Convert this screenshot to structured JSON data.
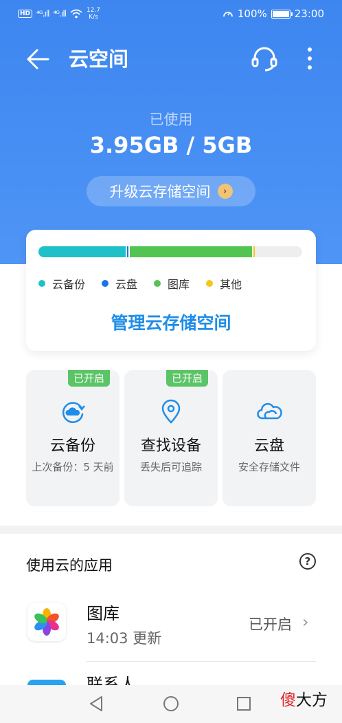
{
  "status_bar": {
    "hd": "HD",
    "sig1": "⁴ᴳ.ıll",
    "sig2": "⁴ᴳ.ıll",
    "speed_value": "12.7",
    "speed_unit": "K/s",
    "battery": "100%",
    "battery_level": 1.0,
    "time": "23:00"
  },
  "header": {
    "title": "云空间"
  },
  "storage": {
    "used_label": "已使用",
    "used_value": "3.95GB / 5GB",
    "upgrade_label": "升级云存储空间",
    "segments": [
      {
        "name": "云备份",
        "fraction": 0.33,
        "color": "#1fc0c7"
      },
      {
        "name": "云盘",
        "fraction": 0.01,
        "color": "#1a73e8"
      },
      {
        "name": "图库",
        "fraction": 0.47,
        "color": "#52c452"
      },
      {
        "name": "其他",
        "fraction": 0.01,
        "color": "#f5c518"
      }
    ],
    "legend": [
      {
        "label": "云备份",
        "color": "#1fc0c7"
      },
      {
        "label": "云盘",
        "color": "#1a73e8"
      },
      {
        "label": "图库",
        "color": "#52c452"
      },
      {
        "label": "其他",
        "color": "#f5c518"
      }
    ],
    "manage_label": "管理云存储空间"
  },
  "tiles": [
    {
      "badge": "已开启",
      "name": "云备份",
      "desc": "上次备份：5 天前",
      "icon": "cloud-backup-icon"
    },
    {
      "badge": "已开启",
      "name": "查找设备",
      "desc": "丢失后可追踪",
      "icon": "location-pin-icon"
    },
    {
      "badge": "",
      "name": "云盘",
      "desc": "安全存储文件",
      "icon": "cloud-icon"
    }
  ],
  "apps": {
    "title": "使用云的应用",
    "help": "?",
    "items": [
      {
        "name": "图库",
        "time": "14:03 更新",
        "status": "已开启"
      }
    ],
    "next_item_name": "联系人"
  },
  "watermark": {
    "red": "傻",
    "rest": "大方"
  },
  "colors": {
    "accent": "#1f8de8",
    "hero": "#3d86f0",
    "badge": "#5bc466"
  }
}
